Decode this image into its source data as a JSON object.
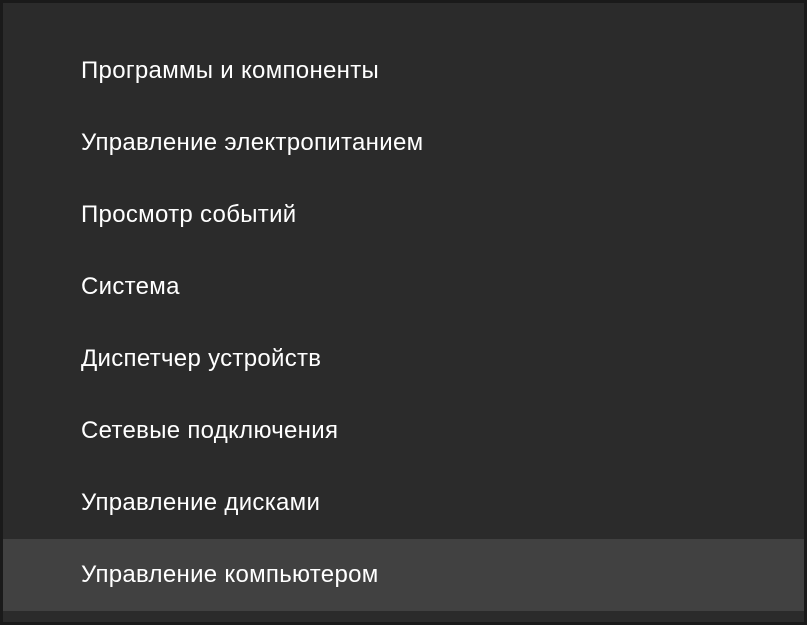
{
  "menu": {
    "items": [
      {
        "label": "Программы и компоненты",
        "hovered": false
      },
      {
        "label": "Управление электропитанием",
        "hovered": false
      },
      {
        "label": "Просмотр событий",
        "hovered": false
      },
      {
        "label": "Система",
        "hovered": false
      },
      {
        "label": "Диспетчер устройств",
        "hovered": false
      },
      {
        "label": "Сетевые подключения",
        "hovered": false
      },
      {
        "label": "Управление дисками",
        "hovered": false
      },
      {
        "label": "Управление компьютером",
        "hovered": true
      }
    ]
  }
}
